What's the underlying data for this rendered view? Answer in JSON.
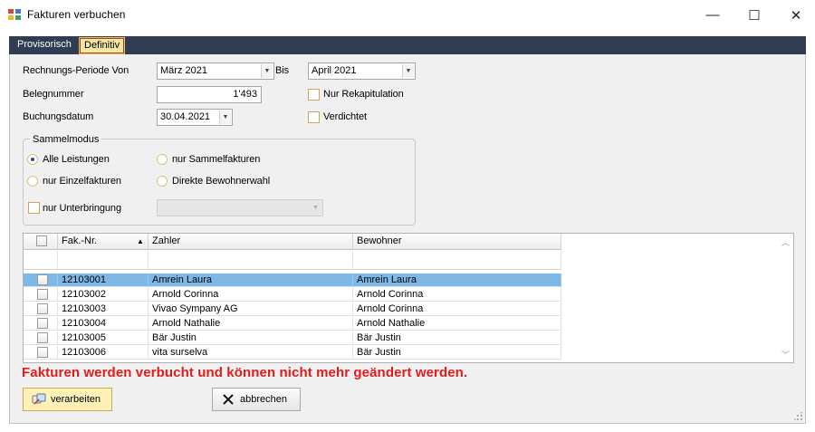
{
  "window": {
    "title": "Fakturen verbuchen",
    "minimize_glyph": "—",
    "maximize_glyph": "☐",
    "close_glyph": "✕"
  },
  "tabs": [
    {
      "label": "Provisorisch",
      "selected": false
    },
    {
      "label": "Definitiv",
      "selected": true
    }
  ],
  "form": {
    "periode_von_label": "Rechnungs-Periode Von",
    "periode_von_value": "März 2021",
    "bis_label": "Bis",
    "bis_value": "April 2021",
    "belegnummer_label": "Belegnummer",
    "belegnummer_value": "1'493",
    "buchungsdatum_label": "Buchungsdatum",
    "buchungsdatum_value": "30.04.2021",
    "nur_rekapitulation_label": "Nur Rekapitulation",
    "verdichtet_label": "Verdichtet"
  },
  "sammelmodus": {
    "title": "Sammelmodus",
    "options": [
      {
        "label": "Alle Leistungen",
        "checked": true
      },
      {
        "label": "nur Sammelfakturen",
        "checked": false
      },
      {
        "label": "nur Einzelfakturen",
        "checked": false
      },
      {
        "label": "Direkte Bewohnerwahl",
        "checked": false
      }
    ],
    "nur_unterbringung_label": "nur Unterbringung",
    "unterbringung_value": ""
  },
  "grid": {
    "columns": [
      "Fak.-Nr.",
      "Zahler",
      "Bewohner"
    ],
    "sort_glyph": "▲",
    "rows": [
      {
        "nr": "12103001",
        "zahler": "Amrein Laura",
        "bewohner": "Amrein Laura",
        "selected": true
      },
      {
        "nr": "12103002",
        "zahler": "Arnold Corinna",
        "bewohner": "Arnold Corinna",
        "selected": false
      },
      {
        "nr": "12103003",
        "zahler": "Vivao Sympany AG",
        "bewohner": "Arnold Corinna",
        "selected": false
      },
      {
        "nr": "12103004",
        "zahler": "Arnold Nathalie",
        "bewohner": "Arnold Nathalie",
        "selected": false
      },
      {
        "nr": "12103005",
        "zahler": "Bär Justin",
        "bewohner": "Bär Justin",
        "selected": false
      },
      {
        "nr": "12103006",
        "zahler": "vita surselva",
        "bewohner": "Bär Justin",
        "selected": false
      }
    ]
  },
  "warning": "Fakturen werden verbucht und können nicht mehr geändert werden.",
  "buttons": {
    "verarbeiten": "verarbeiten",
    "abbrechen": "abbrechen"
  },
  "colors": {
    "warning": "#e11b1b",
    "selected_row": "#7db8e6",
    "tabstrip": "#2f3c52"
  }
}
